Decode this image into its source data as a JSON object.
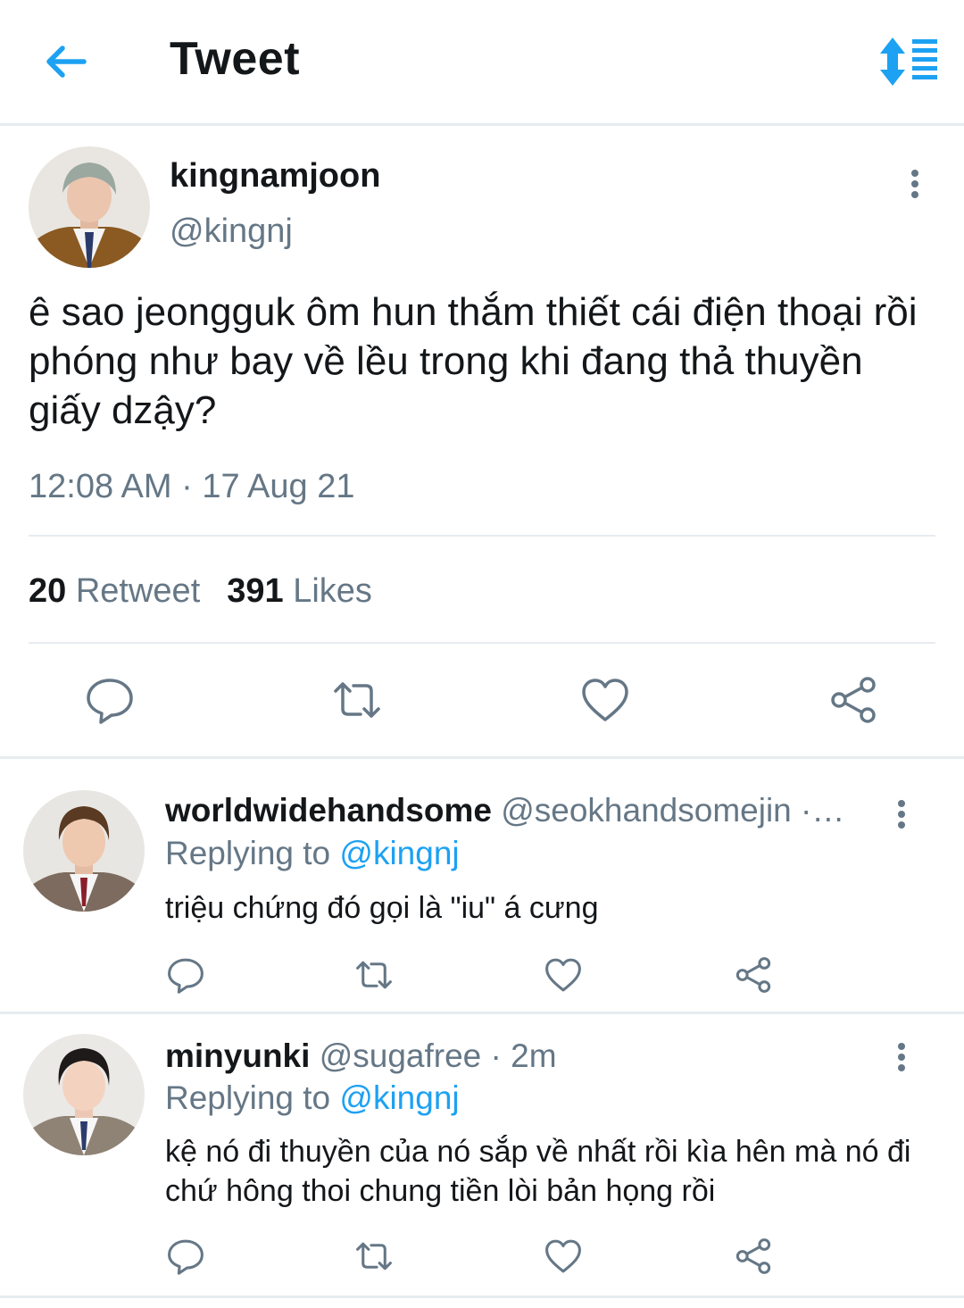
{
  "header": {
    "title": "Tweet",
    "back_icon": "arrow-left-icon",
    "sort_icon": "sort-list-icon",
    "accent_color": "#1da1f2"
  },
  "tweet": {
    "author_name": "kingnamjoon",
    "author_handle": "@kingnj",
    "text": "ê sao jeongguk ôm hun thắm thiết cái điện thoại rồi phóng như bay về lều trong khi đang thả thuyền giấy dzậy?",
    "timestamp": "12:08 AM · 17 Aug 21",
    "retweet_count": "20",
    "retweet_label": "Retweet",
    "like_count": "391",
    "like_label": "Likes",
    "actions": [
      "reply-icon",
      "retweet-icon",
      "like-icon",
      "share-icon"
    ]
  },
  "replies": [
    {
      "name": "worldwidehandsome",
      "handle_meta": "@seokhandsomejin ·…",
      "replying_prefix": "Replying to",
      "replying_to": "@kingnj",
      "text": "triệu chứng đó gọi là \"iu\" á cưng"
    },
    {
      "name": "minyunki",
      "handle_meta": "@sugafree · 2m",
      "replying_prefix": "Replying to",
      "replying_to": "@kingnj",
      "text": "kệ nó đi thuyền của nó sắp về nhất rồi kìa hên mà nó đi chứ hông thoi chung tiền lòi bản họng rồi"
    }
  ]
}
